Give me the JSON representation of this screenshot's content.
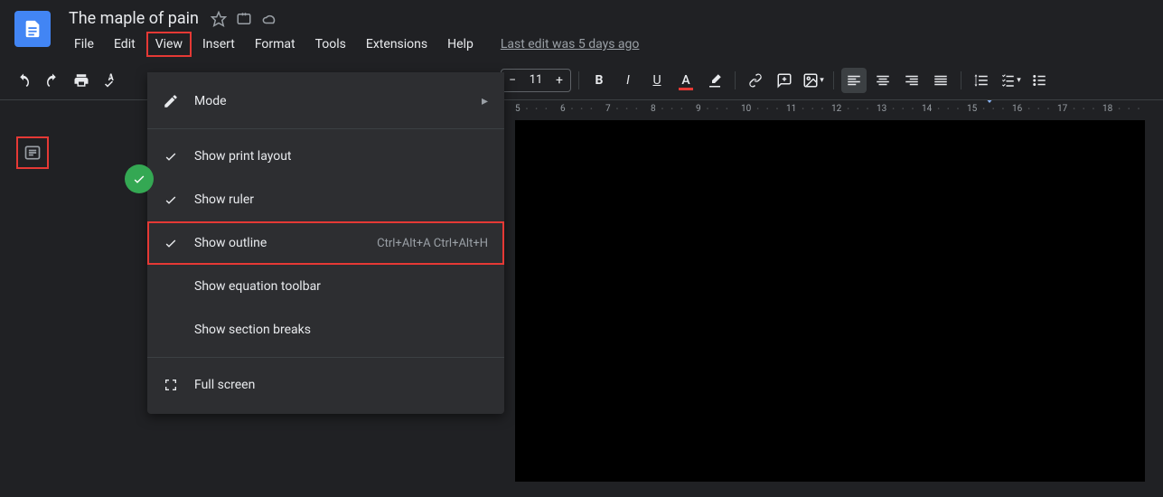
{
  "header": {
    "doc_title": "The maple of pain",
    "last_edit": "Last edit was 5 days ago"
  },
  "menubar": {
    "file": "File",
    "edit": "Edit",
    "view": "View",
    "insert": "Insert",
    "format": "Format",
    "tools": "Tools",
    "extensions": "Extensions",
    "help": "Help"
  },
  "toolbar": {
    "font_size": "11"
  },
  "view_menu": {
    "mode": "Mode",
    "show_print_layout": "Show print layout",
    "show_ruler": "Show ruler",
    "show_outline": "Show outline",
    "show_outline_shortcut": "Ctrl+Alt+A Ctrl+Alt+H",
    "show_equation_toolbar": "Show equation toolbar",
    "show_section_breaks": "Show section breaks",
    "full_screen": "Full screen"
  },
  "ruler": {
    "ticks": [
      "5",
      "6",
      "7",
      "8",
      "9",
      "10",
      "11",
      "12",
      "13",
      "14",
      "15",
      "16",
      "17",
      "18"
    ]
  }
}
